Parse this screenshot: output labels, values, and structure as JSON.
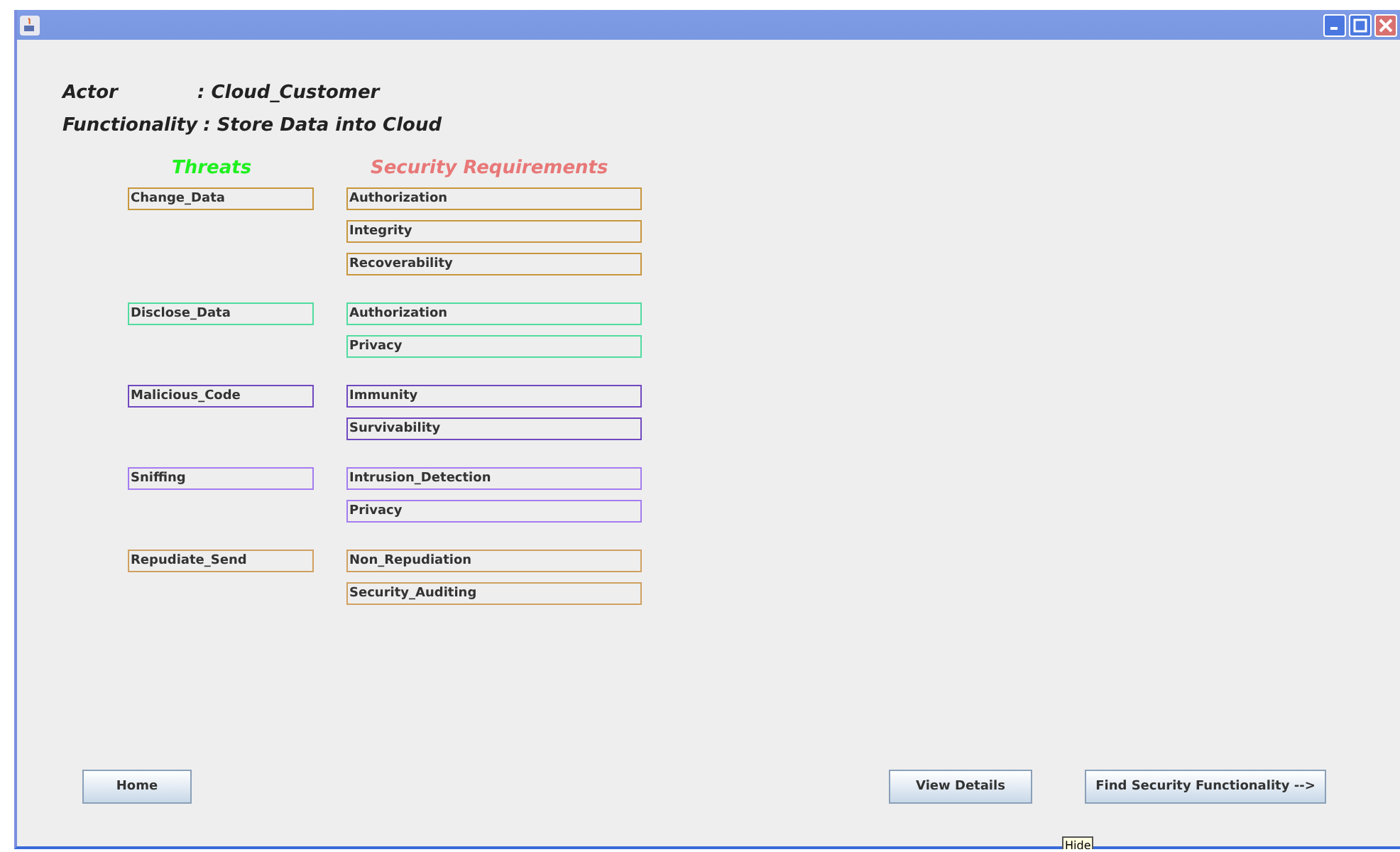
{
  "info": [
    {
      "label": "Actor",
      "value": ": Cloud_Customer"
    },
    {
      "label": "Functionality",
      "value": ": Store Data into Cloud"
    }
  ],
  "headers": {
    "threats": "Threats",
    "requirements": "Security Requirements"
  },
  "groups": [
    {
      "threat": "Change_Data",
      "color": "#c8963c",
      "requirements": [
        "Authorization",
        "Integrity",
        "Recoverability"
      ]
    },
    {
      "threat": "Disclose_Data",
      "color": "#50dca0",
      "requirements": [
        "Authorization",
        "Privacy"
      ]
    },
    {
      "threat": "Malicious_Code",
      "color": "#7048c0",
      "requirements": [
        "Immunity",
        "Survivability"
      ]
    },
    {
      "threat": "Sniffing",
      "color": "#a47cf0",
      "requirements": [
        "Intrusion_Detection",
        "Privacy"
      ]
    },
    {
      "threat": "Repudiate_Send",
      "color": "#d0a060",
      "requirements": [
        "Non_Repudiation",
        "Security_Auditing"
      ]
    }
  ],
  "buttons": {
    "home": "Home",
    "view_details": "View Details",
    "find": "Find Security Functionality -->"
  },
  "tooltip": "Hide"
}
